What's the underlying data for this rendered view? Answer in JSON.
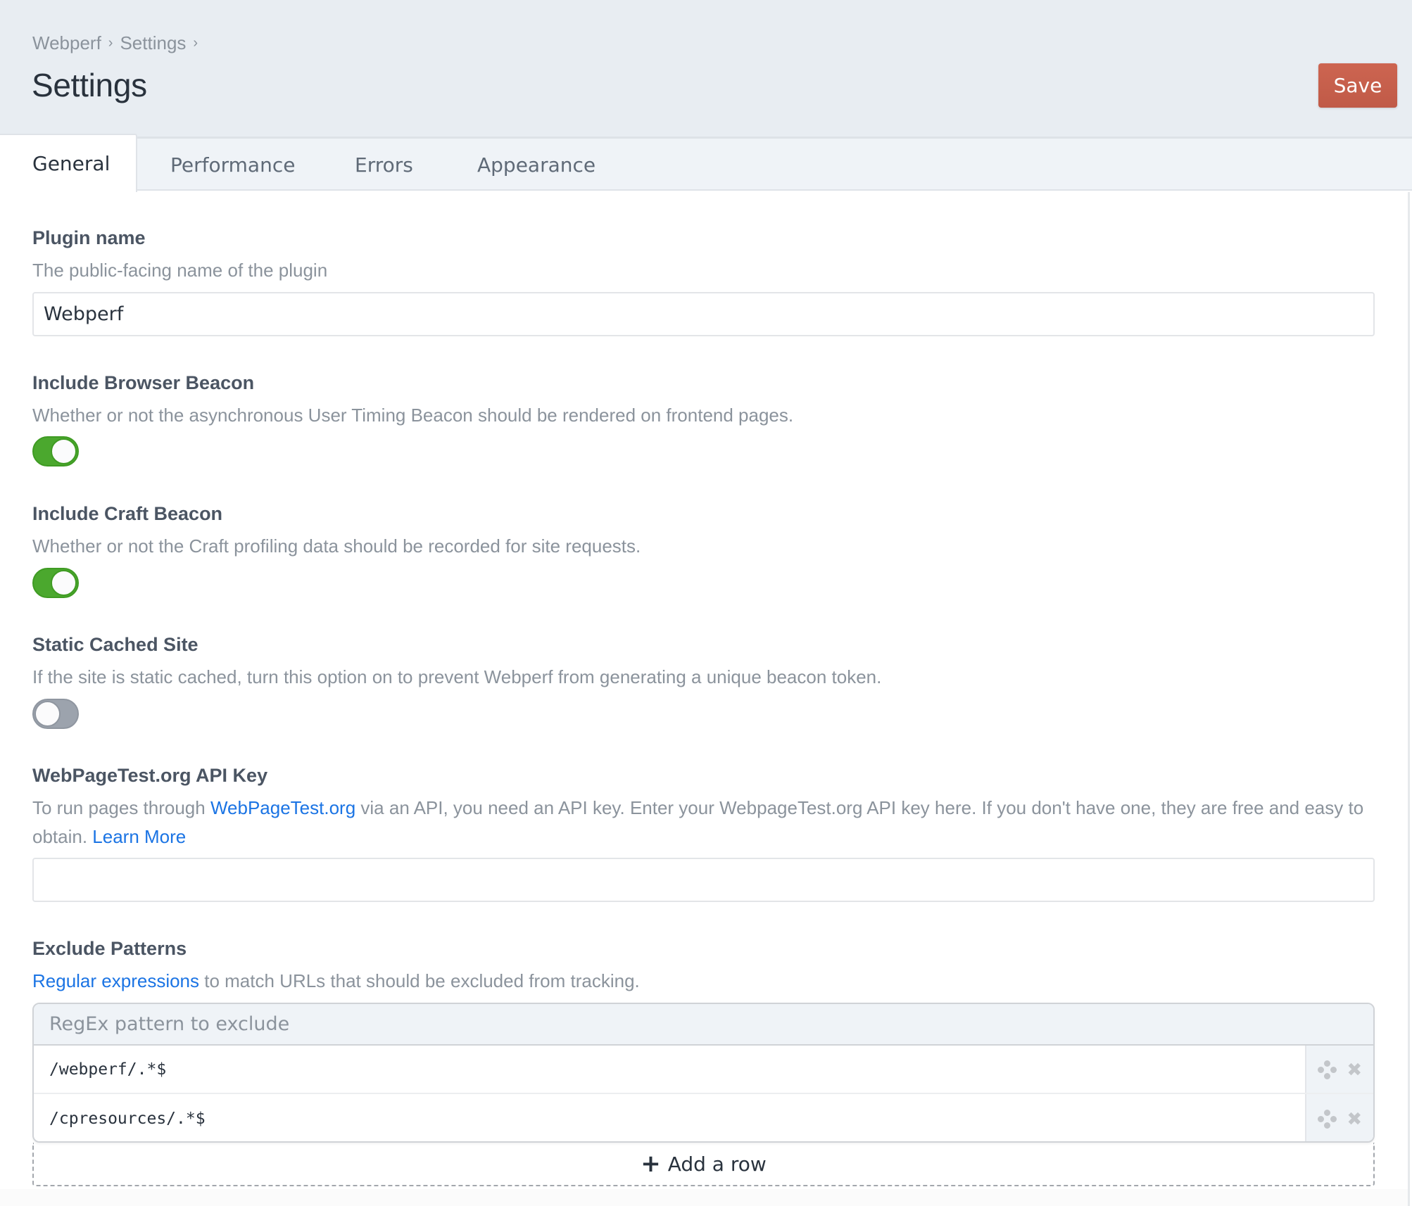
{
  "header": {
    "breadcrumb": [
      "Webperf",
      "Settings"
    ],
    "breadcrumb_separator": "›",
    "title": "Settings",
    "save_label": "Save",
    "save_color": "#c75f4b"
  },
  "tabs": [
    {
      "label": "General",
      "active": true
    },
    {
      "label": "Performance",
      "active": false
    },
    {
      "label": "Errors",
      "active": false
    },
    {
      "label": "Appearance",
      "active": false
    }
  ],
  "fields": {
    "plugin_name": {
      "label": "Plugin name",
      "description": "The public-facing name of the plugin",
      "value": "Webperf"
    },
    "browser_beacon": {
      "label": "Include Browser Beacon",
      "description": "Whether or not the asynchronous User Timing Beacon should be rendered on frontend pages.",
      "enabled": true
    },
    "craft_beacon": {
      "label": "Include Craft Beacon",
      "description": "Whether or not the Craft profiling data should be recorded for site requests.",
      "enabled": true
    },
    "static_cached": {
      "label": "Static Cached Site",
      "description": "If the site is static cached, turn this option on to prevent Webperf from generating a unique beacon token.",
      "enabled": false
    },
    "api_key": {
      "label": "WebPageTest.org API Key",
      "description_prefix": "To run pages through ",
      "description_link": "WebPageTest.org",
      "description_middle": " via an API, you need an API key. Enter your WebpageTest.org API key here. If you don't have one, they are free and easy to obtain. ",
      "description_link2": "Learn More",
      "value": ""
    },
    "exclude_patterns": {
      "label": "Exclude Patterns",
      "description_link": "Regular expressions",
      "description_suffix": " to match URLs that should be excluded from tracking.",
      "column_header": "RegEx pattern to exclude",
      "rows": [
        "/webperf/.*$",
        "/cpresources/.*$"
      ],
      "row_actions": [
        "move-icon",
        "delete-icon"
      ],
      "add_row_label": "Add a row",
      "add_row_icon": "plus-icon"
    }
  },
  "colors": {
    "toggle_on": "#4ba82e",
    "toggle_off": "#9ca3ad",
    "link": "#1b74e4"
  }
}
